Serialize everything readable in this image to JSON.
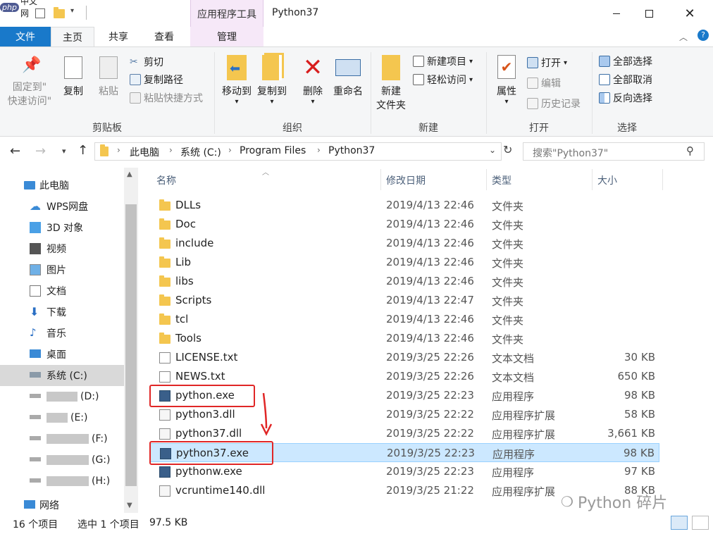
{
  "titlebar": {
    "logo_text": "php",
    "logo_cn": "中文网",
    "context_tab": "应用程序工具",
    "window_title": "Python37",
    "min_icon": "minimize-icon",
    "max_icon": "maximize-icon",
    "close_icon": "close-icon"
  },
  "tabs": {
    "file": "文件",
    "home": "主页",
    "share": "共享",
    "view": "查看",
    "manage": "管理"
  },
  "ribbon": {
    "clipboard": {
      "label": "剪贴板",
      "pin": [
        "固定到\"",
        "快速访问\""
      ],
      "copy": "复制",
      "paste": "粘贴",
      "cut": "剪切",
      "copy_path": "复制路径",
      "paste_shortcut": "粘贴快捷方式"
    },
    "organize": {
      "label": "组织",
      "move_to": "移动到",
      "copy_to": "复制到",
      "delete": "删除",
      "rename": "重命名"
    },
    "new": {
      "label": "新建",
      "new_folder": [
        "新建",
        "文件夹"
      ],
      "new_item": "新建项目",
      "easy_access": "轻松访问"
    },
    "open": {
      "label": "打开",
      "properties": "属性",
      "open": "打开",
      "edit": "编辑",
      "history": "历史记录"
    },
    "select": {
      "label": "选择",
      "select_all": "全部选择",
      "select_none": "全部取消",
      "invert": "反向选择"
    }
  },
  "address": {
    "breadcrumbs": [
      "此电脑",
      "系统 (C:)",
      "Program Files",
      "Python37"
    ],
    "search_placeholder": "搜索\"Python37\""
  },
  "nav": {
    "items": [
      {
        "label": "此电脑",
        "icon": "computer-icon"
      },
      {
        "label": "WPS网盘",
        "icon": "cloud-icon"
      },
      {
        "label": "3D 对象",
        "icon": "3d-objects-icon"
      },
      {
        "label": "视频",
        "icon": "video-icon"
      },
      {
        "label": "图片",
        "icon": "pictures-icon"
      },
      {
        "label": "文档",
        "icon": "documents-icon"
      },
      {
        "label": "下载",
        "icon": "download-icon"
      },
      {
        "label": "音乐",
        "icon": "music-icon"
      },
      {
        "label": "桌面",
        "icon": "desktop-icon"
      },
      {
        "label": "系统 (C:)",
        "icon": "drive-icon"
      },
      {
        "label": "(D:)",
        "icon": "drive-icon"
      },
      {
        "label": "(E:)",
        "icon": "drive-icon"
      },
      {
        "label": "(F:)",
        "icon": "drive-icon"
      },
      {
        "label": "(G:)",
        "icon": "drive-icon"
      },
      {
        "label": "(H:)",
        "icon": "drive-icon"
      },
      {
        "label": "网络",
        "icon": "network-icon"
      }
    ]
  },
  "columns": {
    "name": "名称",
    "date": "修改日期",
    "type": "类型",
    "size": "大小"
  },
  "files": [
    {
      "name": "DLLs",
      "date": "2019/4/13 22:46",
      "type": "文件夹",
      "size": "",
      "icon": "folder-icon"
    },
    {
      "name": "Doc",
      "date": "2019/4/13 22:46",
      "type": "文件夹",
      "size": "",
      "icon": "folder-icon"
    },
    {
      "name": "include",
      "date": "2019/4/13 22:46",
      "type": "文件夹",
      "size": "",
      "icon": "folder-icon"
    },
    {
      "name": "Lib",
      "date": "2019/4/13 22:46",
      "type": "文件夹",
      "size": "",
      "icon": "folder-icon"
    },
    {
      "name": "libs",
      "date": "2019/4/13 22:46",
      "type": "文件夹",
      "size": "",
      "icon": "folder-icon"
    },
    {
      "name": "Scripts",
      "date": "2019/4/13 22:47",
      "type": "文件夹",
      "size": "",
      "icon": "folder-icon"
    },
    {
      "name": "tcl",
      "date": "2019/4/13 22:46",
      "type": "文件夹",
      "size": "",
      "icon": "folder-icon"
    },
    {
      "name": "Tools",
      "date": "2019/4/13 22:46",
      "type": "文件夹",
      "size": "",
      "icon": "folder-icon"
    },
    {
      "name": "LICENSE.txt",
      "date": "2019/3/25 22:26",
      "type": "文本文档",
      "size": "30 KB",
      "icon": "text-file-icon"
    },
    {
      "name": "NEWS.txt",
      "date": "2019/3/25 22:26",
      "type": "文本文档",
      "size": "650 KB",
      "icon": "text-file-icon"
    },
    {
      "name": "python.exe",
      "date": "2019/3/25 22:23",
      "type": "应用程序",
      "size": "98 KB",
      "icon": "python-exe-icon"
    },
    {
      "name": "python3.dll",
      "date": "2019/3/25 22:22",
      "type": "应用程序扩展",
      "size": "58 KB",
      "icon": "dll-icon"
    },
    {
      "name": "python37.dll",
      "date": "2019/3/25 22:22",
      "type": "应用程序扩展",
      "size": "3,661 KB",
      "icon": "dll-icon"
    },
    {
      "name": "python37.exe",
      "date": "2019/3/25 22:23",
      "type": "应用程序",
      "size": "98 KB",
      "icon": "python-exe-icon"
    },
    {
      "name": "pythonw.exe",
      "date": "2019/3/25 22:23",
      "type": "应用程序",
      "size": "97 KB",
      "icon": "python-exe-icon"
    },
    {
      "name": "vcruntime140.dll",
      "date": "2019/3/25 21:22",
      "type": "应用程序扩展",
      "size": "88 KB",
      "icon": "dll-icon"
    }
  ],
  "status": {
    "count": "16 个项目",
    "selected": "选中 1 个项目",
    "size": "97.5 KB"
  },
  "watermark": "Python 碎片",
  "colors": {
    "accent": "#1979ca",
    "selection": "#cce8ff",
    "annotation": "#e02626",
    "folder": "#f4c64f"
  }
}
